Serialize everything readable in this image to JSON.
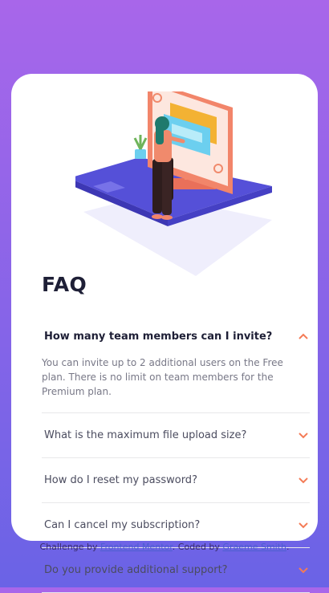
{
  "page": {
    "title": "FAQ",
    "background_gradient": [
      "#a866ea",
      "#6a63e6"
    ],
    "accent": "#f47b56"
  },
  "faq": {
    "items": [
      {
        "question": "How many team members can I invite?",
        "answer": "You can invite up to 2 additional users on the Free plan. There is no limit on team members for the Premium plan.",
        "open": true
      },
      {
        "question": "What is the maximum file upload size?",
        "open": false
      },
      {
        "question": "How do I reset my password?",
        "open": false
      },
      {
        "question": "Can I cancel my subscription?",
        "open": false
      },
      {
        "question": "Do you provide additional support?",
        "open": false
      }
    ],
    "icons": {
      "open": "chevron-up-icon",
      "closed": "chevron-down-icon"
    }
  },
  "footer": {
    "prefix": "Challenge by",
    "challenge_link": "Frontend Mentor",
    "middle": ". Coded by",
    "author_link": "Graeme Smith",
    "suffix": "."
  }
}
